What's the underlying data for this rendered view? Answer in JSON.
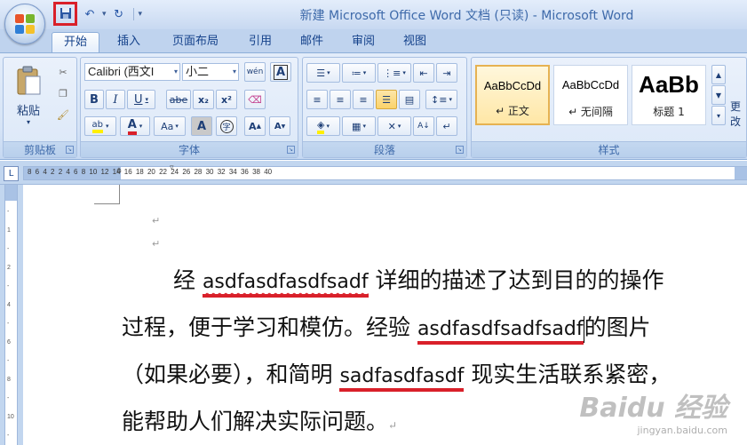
{
  "window": {
    "title": "新建 Microsoft Office Word 文档 (只读) - Microsoft Word"
  },
  "quick_access": {
    "icons": [
      "save-icon",
      "undo-icon",
      "redo-icon",
      "customize-icon"
    ]
  },
  "tabs": [
    {
      "label": "开始",
      "active": true
    },
    {
      "label": "插入"
    },
    {
      "label": "页面布局"
    },
    {
      "label": "引用"
    },
    {
      "label": "邮件"
    },
    {
      "label": "审阅"
    },
    {
      "label": "视图"
    }
  ],
  "ribbon": {
    "clipboard": {
      "label": "剪贴板",
      "paste": "粘贴"
    },
    "font": {
      "label": "字体",
      "font_name": "Calibri (西文I",
      "font_size": "小二",
      "phonetic": "wén",
      "bold": "B",
      "italic": "I",
      "underline": "U",
      "strike": "abe",
      "subscript": "x₂",
      "superscript": "x²",
      "grow": "A",
      "shrink": "A",
      "case": "Aa",
      "shade": "A"
    },
    "paragraph": {
      "label": "段落"
    },
    "styles": {
      "label": "样式",
      "items": [
        {
          "sample": "AaBbCcDd",
          "name": "↵ 正文"
        },
        {
          "sample": "AaBbCcDd",
          "name": "↵ 无间隔"
        },
        {
          "sample": "AaBb",
          "name": "标题 1"
        }
      ],
      "change_label": "更改"
    }
  },
  "ruler": {
    "tab_marker": "L",
    "numbers": "8  6  4  2          2  4  6  8  10  12  14  16  18  20  22  24  26  28  30  32  34  36  38  40"
  },
  "document": {
    "paragraph_marks": [
      "↵",
      "↵"
    ],
    "lines": [
      {
        "pre": "经 ",
        "u": "asdfasdfasdfsadf",
        "post": " 详细的描述了达到目的的操作"
      },
      {
        "pre": "过程，便于学习和模仿。经验 ",
        "u": "asdfasdfsadfsadf",
        "post": "的图片"
      },
      {
        "pre": "（如果必要），和简明 ",
        "u": "sadfasdfasdf",
        "post": " 现实生活联系紧密，"
      },
      {
        "pre": "能帮助人们解决实际问题。",
        "mark": "↵"
      }
    ]
  },
  "watermark": {
    "logo": "Baidu 经验",
    "site": "jingyan.baidu.com"
  }
}
